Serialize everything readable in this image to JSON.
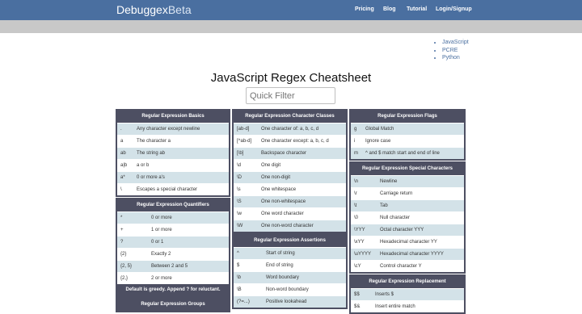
{
  "nav": {
    "brand": "Debuggex",
    "brand_suffix": "Beta",
    "links": [
      "Pricing",
      "Blog",
      "Tutorial",
      "Login/Signup"
    ]
  },
  "flavors": [
    "JavaScript",
    "PCRE",
    "Python"
  ],
  "title": "JavaScript Regex Cheatsheet",
  "filter": {
    "placeholder": "Quick Filter"
  },
  "panels": {
    "basics": {
      "title": "Regular Expression Basics",
      "rows": [
        [
          ".",
          "Any character except newline"
        ],
        [
          "a",
          "The character a"
        ],
        [
          "ab",
          "The string ab"
        ],
        [
          "a|b",
          "a or b"
        ],
        [
          "a*",
          "0 or more a's"
        ],
        [
          "\\",
          "Escapes a special character"
        ]
      ]
    },
    "quantifiers": {
      "title": "Regular Expression Quantifiers",
      "rows": [
        [
          "*",
          "0 or more"
        ],
        [
          "+",
          "1 or more"
        ],
        [
          "?",
          "0 or 1"
        ],
        [
          "{2}",
          "Exactly 2"
        ],
        [
          "{2, 5}",
          "Between 2 and 5"
        ],
        [
          "{2,}",
          "2 or more"
        ]
      ],
      "footer": "Default is greedy. Append ? for reluctant."
    },
    "groups": {
      "title": "Regular Expression Groups",
      "rows": []
    },
    "classes": {
      "title": "Regular Expression Character Classes",
      "rows": [
        [
          "[ab-d]",
          "One character of: a, b, c, d"
        ],
        [
          "[^ab-d]",
          "One character except: a, b, c, d"
        ],
        [
          "[\\b]",
          "Backspace character"
        ],
        [
          "\\d",
          "One digit"
        ],
        [
          "\\D",
          "One non-digit"
        ],
        [
          "\\s",
          "One whitespace"
        ],
        [
          "\\S",
          "One non-whitespace"
        ],
        [
          "\\w",
          "One word character"
        ],
        [
          "\\W",
          "One non-word character"
        ]
      ]
    },
    "assertions": {
      "title": "Regular Expression Assertions",
      "rows": [
        [
          "^",
          "Start of string"
        ],
        [
          "$",
          "End of string"
        ],
        [
          "\\b",
          "Word boundary"
        ],
        [
          "\\B",
          "Non-word boundary"
        ],
        [
          "(?=...)",
          "Positive lookahead"
        ]
      ]
    },
    "flags": {
      "title": "Regular Expression Flags",
      "rows": [
        [
          "g",
          "Global Match"
        ],
        [
          "i",
          "Ignore case"
        ],
        [
          "m",
          "^ and $ match start and end of line"
        ]
      ]
    },
    "special": {
      "title": "Regular Expression Special Characters",
      "rows": [
        [
          "\\n",
          "Newline"
        ],
        [
          "\\r",
          "Carriage return"
        ],
        [
          "\\t",
          "Tab"
        ],
        [
          "\\0",
          "Null character"
        ],
        [
          "\\YYY",
          "Octal character YYY"
        ],
        [
          "\\xYY",
          "Hexadecimal character YY"
        ],
        [
          "\\uYYYY",
          "Hexadecimal character YYYY"
        ],
        [
          "\\cY",
          "Control character Y"
        ]
      ]
    },
    "replacement": {
      "title": "Regular Expression Replacement",
      "rows": [
        [
          "$$",
          "Inserts $"
        ],
        [
          "$&",
          "Insert entire match"
        ]
      ]
    }
  }
}
